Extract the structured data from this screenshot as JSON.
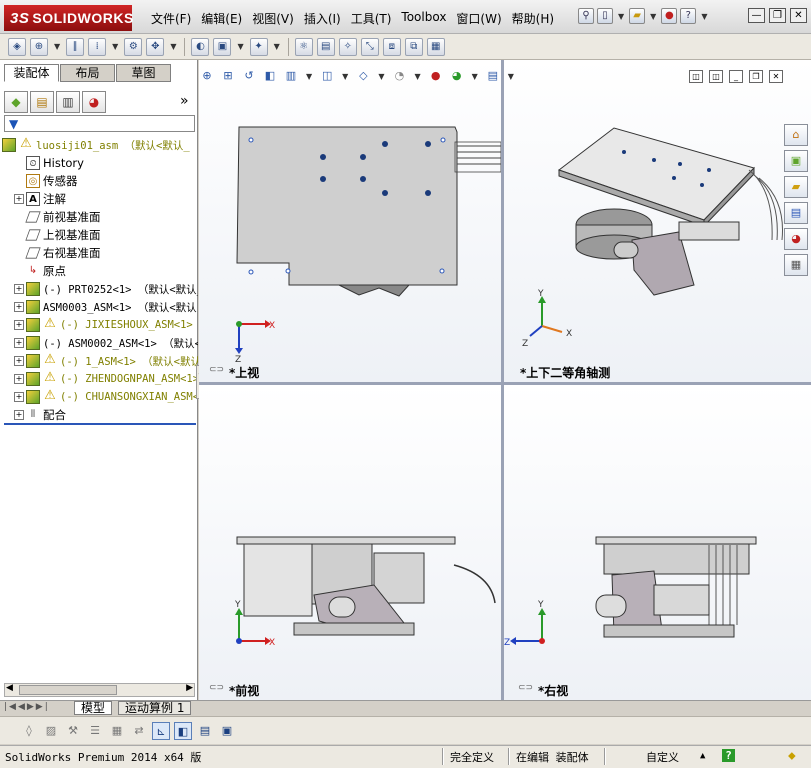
{
  "app": {
    "brand_prefix": "3S",
    "brand_name": "SOLIDWORKS"
  },
  "menu": [
    "文件(F)",
    "编辑(E)",
    "视图(V)",
    "插入(I)",
    "工具(T)",
    "Toolbox",
    "窗口(W)",
    "帮助(H)"
  ],
  "title_tools": {
    "help_label": "?"
  },
  "window_controls": {
    "minimize": "—",
    "restore": "❐",
    "close": "✕"
  },
  "panel_tabs": [
    "装配体",
    "布局",
    "草图"
  ],
  "tree": {
    "root": "luosiji01_asm （默认<默认_",
    "items": [
      {
        "label": "History",
        "icon": "history-icon"
      },
      {
        "label": "传感器",
        "icon": "sensor-icon"
      },
      {
        "label": "注解",
        "icon": "annotation-icon"
      },
      {
        "label": "前视基准面",
        "icon": "plane-icon"
      },
      {
        "label": "上视基准面",
        "icon": "plane-icon"
      },
      {
        "label": "右视基准面",
        "icon": "plane-icon"
      },
      {
        "label": "原点",
        "icon": "origin-icon"
      },
      {
        "label": "(-) PRT0252<1> （默认<默认_",
        "icon": "part-icon",
        "warn": false
      },
      {
        "label": "ASM0003_ASM<1> （默认<默认",
        "icon": "assembly-icon",
        "warn": false
      },
      {
        "label": "(-) JIXIESHOUX_ASM<1>",
        "icon": "assembly-icon",
        "warn": true
      },
      {
        "label": "(-) ASM0002_ASM<1> （默认<默",
        "icon": "assembly-icon",
        "warn": false
      },
      {
        "label": "(-) 1_ASM<1> （默认<默认_",
        "icon": "assembly-icon",
        "warn": true
      },
      {
        "label": "(-) ZHENDOGNPAN_ASM<1>",
        "icon": "assembly-icon",
        "warn": true
      },
      {
        "label": "(-) CHUANSONGXIAN_ASM<1>",
        "icon": "assembly-icon",
        "warn": true
      },
      {
        "label": "配合",
        "icon": "mates-icon"
      }
    ]
  },
  "viewports": {
    "top_left": "*上视",
    "top_right": "*上下二等角轴测",
    "bottom_left": "*前视",
    "bottom_right": "*右视"
  },
  "axes": {
    "x": "X",
    "y": "Y",
    "z": "Z"
  },
  "bottom_tabs": [
    "模型",
    "运动算例 1"
  ],
  "status": {
    "product": "SolidWorks Premium 2014 x64 版",
    "definition": "完全定义",
    "editing": "在编辑 装配体",
    "units": "自定义",
    "help": "?"
  },
  "colors": {
    "accent": "#2a56b8",
    "brand": "#c01818",
    "axis_x": "#d02020",
    "axis_y": "#2a9a2a",
    "axis_z": "#2040c0"
  }
}
